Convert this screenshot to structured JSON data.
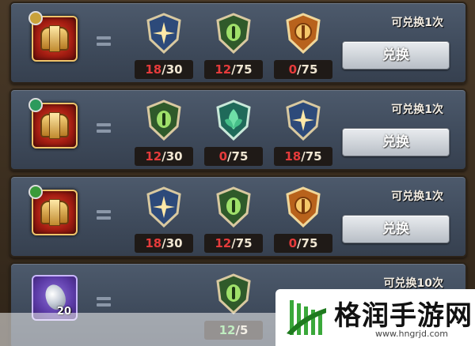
{
  "colors": {
    "have_short": "#e53b3b",
    "have_ok": "#7ee07e",
    "button_bg": "#c8cdd3",
    "row_bg": "#44505f"
  },
  "rows": [
    {
      "reward_icon": "golden-chest-icon",
      "limit_text": "可兑换1次",
      "button_label": "兑换",
      "costs": [
        {
          "icon": "blue-star-shield-icon",
          "have": "18",
          "need": "/30"
        },
        {
          "icon": "green-eye-shield-icon",
          "have": "12",
          "need": "/75"
        },
        {
          "icon": "orange-emblem-shield-icon",
          "have": "0",
          "need": "/75"
        }
      ]
    },
    {
      "reward_icon": "golden-chest-icon",
      "limit_text": "可兑换1次",
      "button_label": "兑换",
      "costs": [
        {
          "icon": "green-eye-shield-icon",
          "have": "12",
          "need": "/30"
        },
        {
          "icon": "green-leaf-shield-icon",
          "have": "0",
          "need": "/75"
        },
        {
          "icon": "blue-star-shield-icon",
          "have": "18",
          "need": "/75"
        }
      ]
    },
    {
      "reward_icon": "golden-chest-icon",
      "limit_text": "可兑换1次",
      "button_label": "兑换",
      "costs": [
        {
          "icon": "blue-star-shield-icon",
          "have": "18",
          "need": "/30"
        },
        {
          "icon": "green-eye-shield-icon",
          "have": "12",
          "need": "/75"
        },
        {
          "icon": "orange-emblem-shield-icon",
          "have": "0",
          "need": "/75"
        }
      ]
    },
    {
      "reward_icon": "silver-crystal-icon",
      "reward_count": "20",
      "limit_text": "可兑换10次",
      "costs": [
        {
          "icon": "green-eye-shield-icon",
          "have": "12",
          "need": "/5"
        }
      ]
    }
  ],
  "watermark": {
    "text": "格润手游网",
    "url": "www.hngrjd.com"
  }
}
